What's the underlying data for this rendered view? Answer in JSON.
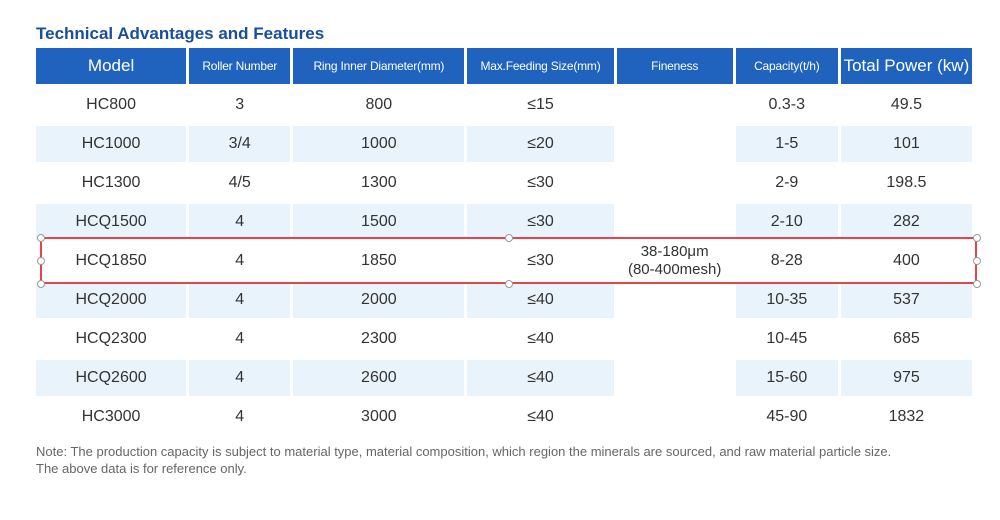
{
  "title": "Technical Advantages and Features",
  "table": {
    "headers": [
      "Model",
      "Roller Number",
      "Ring Inner Diameter(mm)",
      "Max.Feeding Size(mm)",
      "Fineness",
      "Capacity(t/h)",
      "Total Power (kw)"
    ],
    "rows": [
      [
        "HC800",
        "3",
        "800",
        "≤15",
        "0.3-3",
        "49.5"
      ],
      [
        "HC1000",
        "3/4",
        "1000",
        "≤20",
        "1-5",
        "101"
      ],
      [
        "HC1300",
        "4/5",
        "1300",
        "≤30",
        "2-9",
        "198.5"
      ],
      [
        "HCQ1500",
        "4",
        "1500",
        "≤30",
        "2-10",
        "282"
      ],
      [
        "HCQ1850",
        "4",
        "1850",
        "≤30",
        "8-28",
        "400"
      ],
      [
        "HCQ2000",
        "4",
        "2000",
        "≤40",
        "10-35",
        "537"
      ],
      [
        "HCQ2300",
        "4",
        "2300",
        "≤40",
        "10-45",
        "685"
      ],
      [
        "HCQ2600",
        "4",
        "2600",
        "≤40",
        "15-60",
        "975"
      ],
      [
        "HC3000",
        "4",
        "3000",
        "≤40",
        "45-90",
        "1832"
      ]
    ],
    "fineness": [
      "38-180μm",
      "(80-400mesh)"
    ],
    "highlighted_row": "HCQ1850"
  },
  "note": {
    "line1": "Note: The production capacity is subject to material type, material composition, which region the minerals are sourced, and raw material particle size.",
    "line2": "The above data is for reference only."
  },
  "colors": {
    "header_bg": "#1f63be",
    "title": "#1a4e9c",
    "stripe": "#e9f3fc",
    "highlight_border": "#e0474d"
  }
}
